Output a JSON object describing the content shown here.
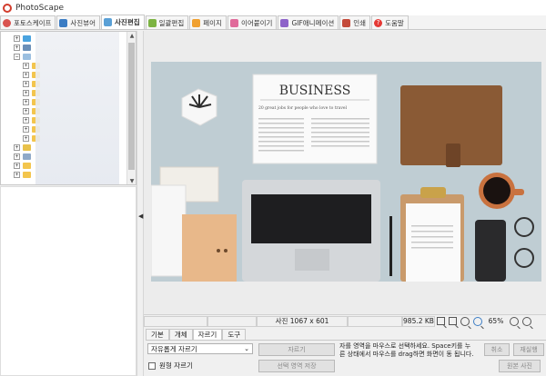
{
  "app": {
    "title": "PhotoScape"
  },
  "tabs": [
    {
      "label": "포토스케이프",
      "color": "#d9534f"
    },
    {
      "label": "사진뷰어",
      "color": "#3c7dc4"
    },
    {
      "label": "사진편집",
      "color": "#5aa0d6",
      "active": true
    },
    {
      "label": "일괄편집",
      "color": "#7cb342"
    },
    {
      "label": "페이지",
      "color": "#f0a030"
    },
    {
      "label": "이어붙이기",
      "color": "#e06b9a"
    },
    {
      "label": "GIF애니메이션",
      "color": "#8e63c9"
    },
    {
      "label": "인쇄",
      "color": "#c44b3b"
    },
    {
      "label": "도움말",
      "color": "#e53935"
    }
  ],
  "tree": {
    "expander_symbols": {
      "collapsed": "+",
      "expanded": "−"
    }
  },
  "statusbar": {
    "dimensions": "사진 1067 x 601",
    "filesize": "985.2 KB",
    "zoom": "65%"
  },
  "bottom_tabs": [
    "기본",
    "개체",
    "자르기",
    "도구"
  ],
  "bottom_active_tab": "자르기",
  "crop": {
    "mode_select": "자유롭게 자르기",
    "round_checkbox": "원형 자르기",
    "crop_button": "자르기",
    "save_selection_button": "선택 영역 저장",
    "help_text": "자를 영역을 마우스로 선택하세요. Space키를 누른 상태에서 마우스를 drag하면 화면이 동 됩니다."
  },
  "right_buttons": {
    "cancel": "취소",
    "redo": "재실행",
    "original": "원본 사진"
  },
  "photo": {
    "newspaper_title": "BUSINESS",
    "newspaper_headline": "20 great jobs for people who love to travel",
    "colors": {
      "background": "#bfcdd3",
      "laptop": "#d4d7da",
      "keyboard": "#1e1e20",
      "notebook": "#8a5a35",
      "folder": "#e8b88a",
      "mug": "#c9723f"
    }
  }
}
